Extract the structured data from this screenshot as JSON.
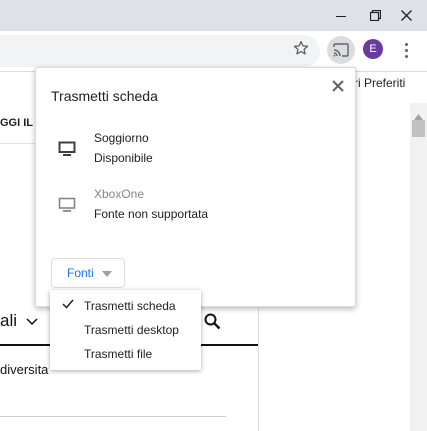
{
  "browser": {
    "profile_initial": "E",
    "accent_color": "#6a3b9e",
    "bookmarks_bar": {
      "other_bookmarks": "ltri Preferiti",
      "left_fragment": "GGI IL"
    }
  },
  "page": {
    "heading_fragment": "ali",
    "subtext_fragment": "diversita"
  },
  "cast_dialog": {
    "title": "Trasmetti scheda",
    "sinks": [
      {
        "name": "Soggiorno",
        "status": "Disponibile",
        "icon": "monitor-icon",
        "enabled": true
      },
      {
        "name": "XboxOne",
        "status": "Fonte non supportata",
        "icon": "monitor-icon",
        "enabled": false
      }
    ],
    "sources_button": "Fonti",
    "sources_menu": [
      {
        "label": "Trasmetti scheda",
        "selected": true
      },
      {
        "label": "Trasmetti desktop",
        "selected": false
      },
      {
        "label": "Trasmetti file",
        "selected": false
      }
    ]
  }
}
